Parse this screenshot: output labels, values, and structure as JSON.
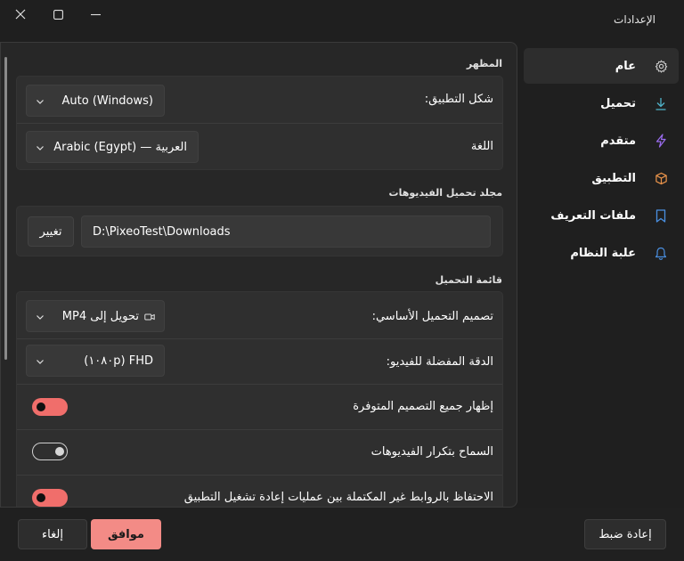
{
  "window": {
    "title": "الإعدادات"
  },
  "colors": {
    "accent": "#f38b86",
    "toggle_on": "#f06e6b",
    "panel_bg": "#272727",
    "card_bg": "#2f2f2f"
  },
  "sidebar": {
    "items": [
      {
        "label": "عام",
        "icon": "gear-icon",
        "icon_color": "#d0d0d0",
        "active": true
      },
      {
        "label": "تحميل",
        "icon": "download-icon",
        "icon_color": "#4fb3c9",
        "active": false
      },
      {
        "label": "متقدم",
        "icon": "lightning-icon",
        "icon_color": "#9b6cf0",
        "active": false
      },
      {
        "label": "التطبيق",
        "icon": "package-icon",
        "icon_color": "#e9934a",
        "active": false
      },
      {
        "label": "ملفات التعريف",
        "icon": "bookmark-icon",
        "icon_color": "#4a90e2",
        "active": false
      },
      {
        "label": "علبة النظام",
        "icon": "bell-icon",
        "icon_color": "#4a90e2",
        "active": false
      }
    ]
  },
  "appearance": {
    "section_title": "المظهر",
    "theme_label": "شكل التطبيق:",
    "theme_value": "Auto (Windows)",
    "language_label": "اللغة",
    "language_value": "العربية — Arabic (Egypt)"
  },
  "download_folder": {
    "section_title": "مجلد تحميل الفيديوهات",
    "path": "D:\\PixeoTest\\Downloads",
    "change_label": "تغيير"
  },
  "download_list": {
    "section_title": "قائمة التحميل",
    "preset_label": "تصميم التحميل الأساسي:",
    "preset_value": "تحويل إلى MP4",
    "resolution_label": "الدقة المفضلة للفيديو:",
    "resolution_value": "FHD (١٠٨٠p)",
    "toggles": [
      {
        "label": "إظهار جميع التصميم المتوفرة",
        "on": true
      },
      {
        "label": "السماح بتكرار الفيديوهات",
        "on": false
      },
      {
        "label": "الاحتفاظ بالروابط غير المكتملة بين عمليات إعادة تشغيل التطبيق",
        "on": true
      }
    ]
  },
  "footer": {
    "reset_label": "إعادة ضبط",
    "ok_label": "موافق",
    "cancel_label": "إلغاء"
  }
}
